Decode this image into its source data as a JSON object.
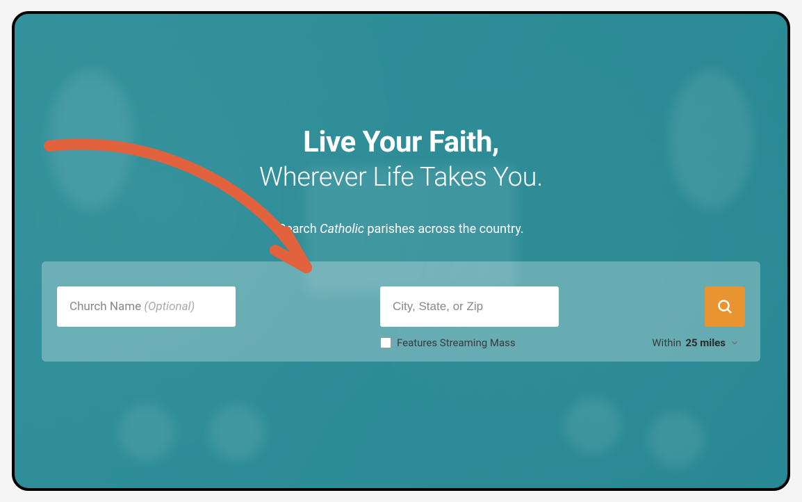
{
  "hero": {
    "headline_bold": "Live Your Faith,",
    "headline_light": "Wherever Life Takes You.",
    "subline_prefix": "Search ",
    "subline_italic": "Catholic",
    "subline_suffix": " parishes across the country."
  },
  "search": {
    "church_placeholder_main": "Church Name ",
    "church_placeholder_optional": "(Optional)",
    "location_placeholder": "City, State, or Zip",
    "streaming_checkbox_label": "Features Streaming Mass",
    "streaming_checked": false,
    "radius_prefix": "Within ",
    "radius_value": "25 miles",
    "search_button_aria": "Search"
  },
  "colors": {
    "accent_orange": "#e89430",
    "annotation_arrow": "#e1623d",
    "hero_teal": "#3e969f"
  }
}
